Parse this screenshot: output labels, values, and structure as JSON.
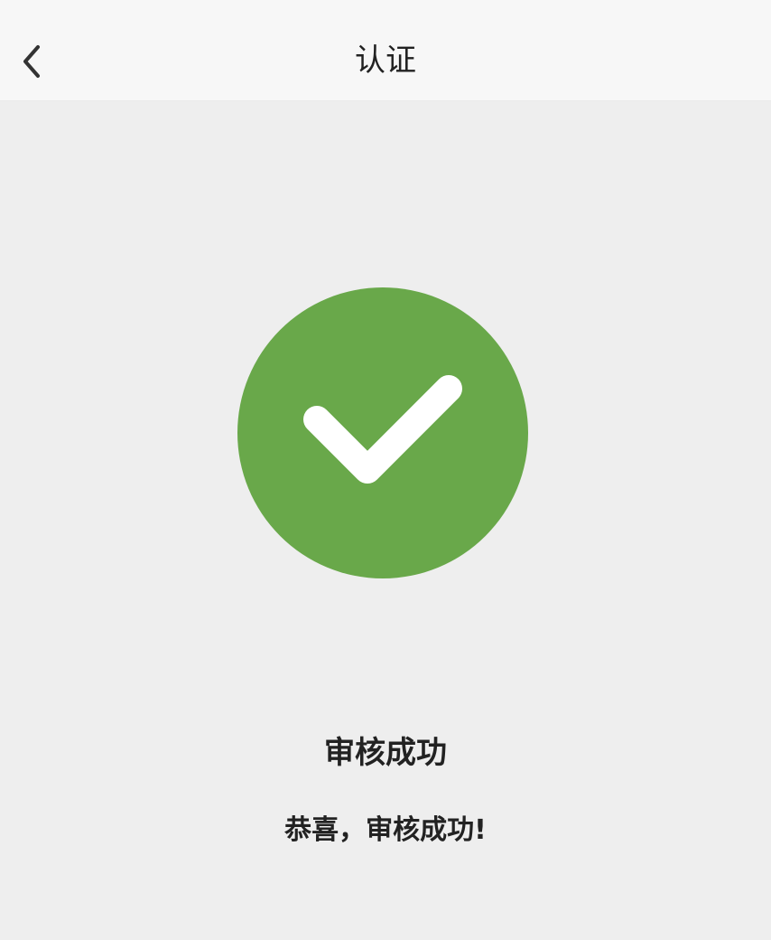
{
  "header": {
    "title": "认证",
    "back_icon": "chevron-left-icon"
  },
  "status": {
    "icon": "checkmark-icon",
    "color": "#69a84a",
    "title": "审核成功",
    "message": "恭喜，审核成功!"
  }
}
